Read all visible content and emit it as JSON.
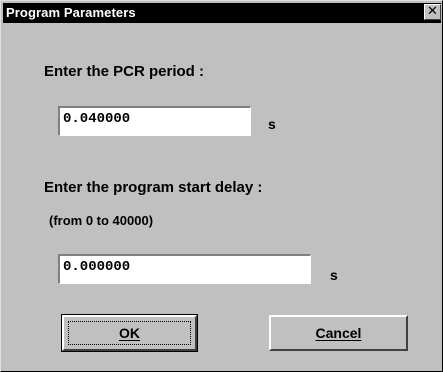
{
  "window": {
    "title": "Program Parameters",
    "close_glyph": "✕"
  },
  "pcr": {
    "label": "Enter the PCR period :",
    "value": "0.040000",
    "unit": "s"
  },
  "delay": {
    "label": "Enter the program start delay :",
    "range": "(from 0 to 40000)",
    "value": "0.000000",
    "unit": "s"
  },
  "buttons": {
    "ok_label": "OK",
    "cancel_label": "Cancel"
  }
}
